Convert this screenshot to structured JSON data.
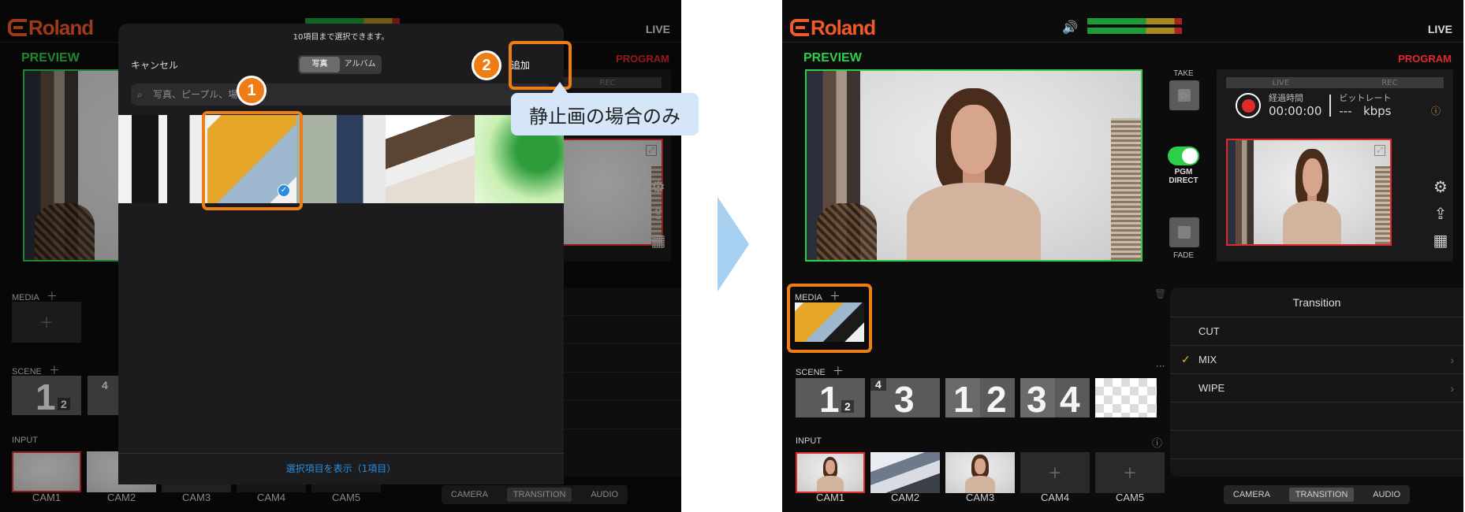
{
  "brand": {
    "name": "Roland",
    "accent": "#f05a28"
  },
  "status": {
    "live": "LIVE",
    "speaker_icon": "speaker-icon"
  },
  "labels": {
    "preview": "PREVIEW",
    "program": "PROGRAM",
    "media": "MEDIA",
    "scene": "SCENE",
    "input": "INPUT"
  },
  "recorder": {
    "live_tab": "LIVE",
    "rec_tab": "REC",
    "elapsed_label": "経過時間",
    "elapsed_value": "00:00:00",
    "bitrate_label": "ビットレート",
    "bitrate_value": "---",
    "bitrate_unit": "kbps"
  },
  "controls": {
    "take": "TAKE",
    "pgm_direct_1": "PGM",
    "pgm_direct_2": "DIRECT",
    "fade": "FADE"
  },
  "scenes": [
    {
      "a": "1",
      "b": "2"
    },
    {
      "a": "4",
      "b": "3"
    },
    {
      "a": "1",
      "b": "2"
    },
    {
      "a": "3",
      "b": "4"
    }
  ],
  "inputs": [
    "CAM1",
    "CAM2",
    "CAM3",
    "CAM4",
    "CAM5"
  ],
  "bottom_tabs": [
    "CAMERA",
    "TRANSITION",
    "AUDIO"
  ],
  "transition": {
    "title": "Transition",
    "items": [
      "CUT",
      "MIX",
      "WIPE"
    ],
    "selected": "MIX",
    "check": "✓"
  },
  "picker": {
    "info": "10項目まで選択できます。",
    "cancel": "キャンセル",
    "tabs": [
      "写真",
      "アルバム"
    ],
    "add": "追加",
    "search_placeholder": "写真、ピープル、場",
    "footer": "選択項目を表示（1項目）"
  },
  "annotations": {
    "step1": "1",
    "step2": "2",
    "callout": "静止画の場合のみ"
  },
  "colors": {
    "preview_green": "#2fce4a",
    "program_red": "#e0292b",
    "highlight_orange": "#ef7d16",
    "ios_blue": "#2a8de0"
  }
}
